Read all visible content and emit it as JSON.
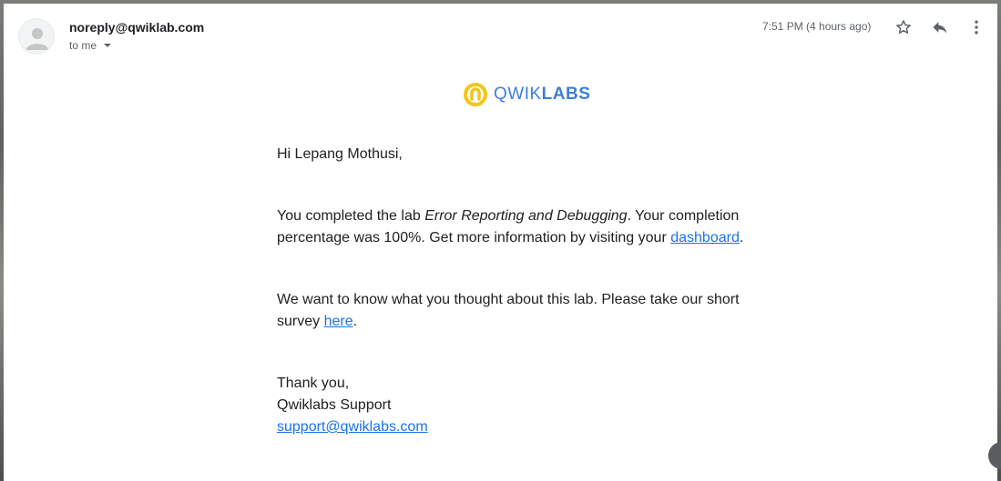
{
  "email": {
    "sender": "noreply@qwiklab.com",
    "recipient_label": "to me",
    "timestamp": "7:51 PM (4 hours ago)"
  },
  "icons": {
    "avatar": "person-icon",
    "star": "star-icon",
    "reply": "reply-icon",
    "more": "more-vert-icon",
    "caret": "caret-down-icon"
  },
  "logo": {
    "text_light": "QWIK",
    "text_bold": "LABS",
    "color_blue": "#3d7fd6",
    "color_yellow": "#f5c518"
  },
  "message": {
    "greeting": "Hi Lepang Mothusi,",
    "p1_before": "You completed the lab ",
    "p1_lab": "Error Reporting and Debugging",
    "p1_mid": ". Your completion percentage was 100%. Get more information by visiting your ",
    "p1_link": "dashboard",
    "p1_end": ".",
    "p2_before": "We want to know what you thought about this lab. Please take our short survey ",
    "p2_link": "here",
    "p2_end": ".",
    "closing": "Thank you,",
    "signature": "Qwiklabs Support",
    "support_email": "support@qwiklabs.com"
  },
  "colors": {
    "link": "#1a73e8",
    "text": "#202124",
    "muted": "#5f6368"
  }
}
